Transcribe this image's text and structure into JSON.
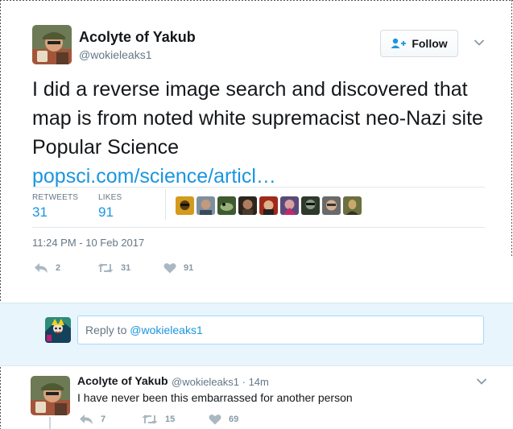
{
  "tweet": {
    "display_name": "Acolyte of Yakub",
    "handle": "@wokieleaks1",
    "follow_label": "Follow",
    "text": "I did a reverse image search and discovered that map is from noted white supremacist neo-Nazi site Popular Science",
    "link": "popsci.com/science/articl…",
    "stats": {
      "retweets_label": "RETWEETS",
      "retweets": "31",
      "likes_label": "LIKES",
      "likes": "91"
    },
    "timestamp": "11:24 PM - 10 Feb 2017",
    "actions": {
      "reply_count": "2",
      "retweet_count": "31",
      "like_count": "91"
    }
  },
  "reply_bar": {
    "prefix": "Reply to ",
    "mention": "@wokieleaks1"
  },
  "reply": {
    "display_name": "Acolyte of Yakub",
    "meta": "@wokieleaks1 · 14m",
    "text": "I have never been this embarrassed for another person",
    "actions": {
      "reply_count": "7",
      "retweet_count": "15",
      "like_count": "69"
    }
  },
  "colors": {
    "link": "#1b95e0",
    "muted": "#657786",
    "reply_bg": "#e8f5fd"
  },
  "icons": [
    "follow-person-plus-icon",
    "chevron-down-icon",
    "reply-arrow-icon",
    "retweet-icon",
    "heart-icon"
  ]
}
